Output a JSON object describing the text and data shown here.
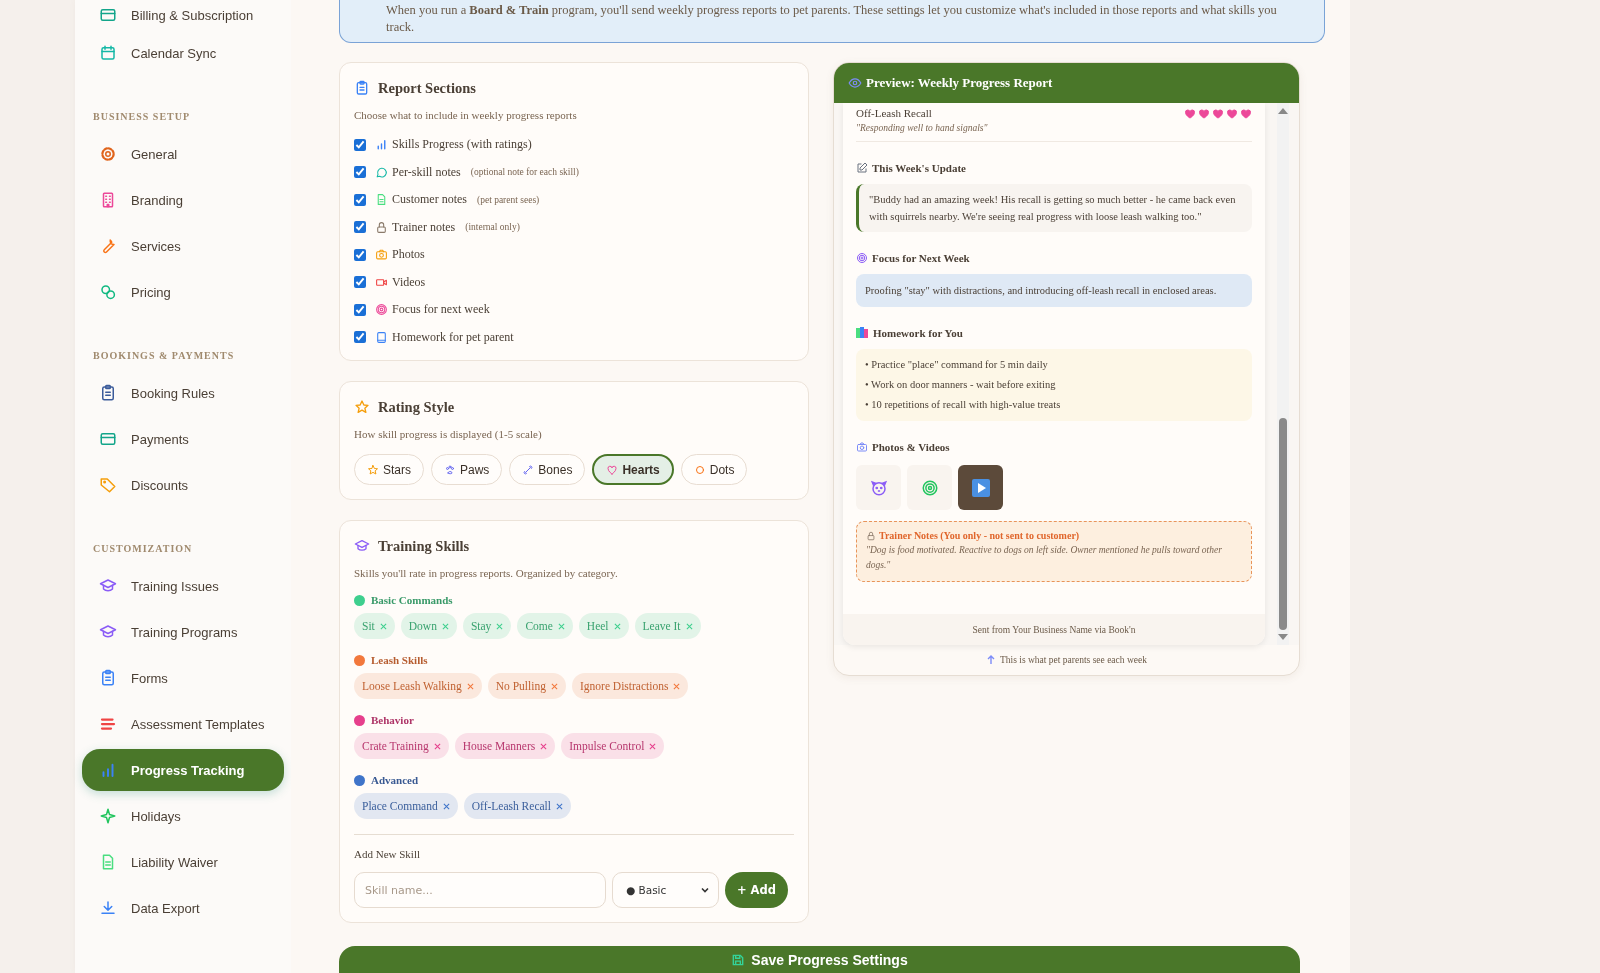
{
  "sidebar": {
    "sections": [
      {
        "items": [
          {
            "label": "Billing & Subscription",
            "kind": "card",
            "selected": false
          },
          {
            "label": "Calendar Sync",
            "kind": "calendar",
            "selected": false
          }
        ]
      },
      {
        "title": "BUSINESS SETUP",
        "items": [
          {
            "label": "General",
            "kind": "gear",
            "selected": false
          },
          {
            "label": "Branding",
            "kind": "building",
            "selected": false
          },
          {
            "label": "Services",
            "kind": "wrench",
            "selected": false
          },
          {
            "label": "Pricing",
            "kind": "coins",
            "selected": false
          }
        ]
      },
      {
        "title": "BOOKINGS & PAYMENTS",
        "items": [
          {
            "label": "Booking Rules",
            "kind": "clipboard",
            "selected": false
          },
          {
            "label": "Payments",
            "kind": "card",
            "selected": false
          },
          {
            "label": "Discounts",
            "kind": "tag",
            "selected": false
          }
        ]
      },
      {
        "title": "CUSTOMIZATION",
        "items": [
          {
            "label": "Training Issues",
            "kind": "cap",
            "selected": false
          },
          {
            "label": "Training Programs",
            "kind": "cap",
            "selected": false
          },
          {
            "label": "Forms",
            "kind": "form",
            "selected": false
          },
          {
            "label": "Assessment Templates",
            "kind": "lines",
            "selected": false
          },
          {
            "label": "Progress Tracking",
            "kind": "chart",
            "selected": true
          },
          {
            "label": "Holidays",
            "kind": "sparkle",
            "selected": false
          },
          {
            "label": "Liability Waiver",
            "kind": "doc",
            "selected": false
          },
          {
            "label": "Data Export",
            "kind": "download",
            "selected": false
          }
        ]
      }
    ]
  },
  "banner": {
    "text": "When you run a **Board & Train** program, you'll send weekly progress reports to pet parents. These settings let you customize what's included in those reports and what skills you track."
  },
  "report_sections": {
    "title": "Report Sections",
    "subtitle": "Choose what to include in weekly progress reports",
    "items": [
      {
        "label": "Skills Progress (with ratings)",
        "kind": "chart",
        "checked": true
      },
      {
        "label": "Per-skill notes",
        "note": "(optional note for each skill)",
        "kind": "chat",
        "checked": true
      },
      {
        "label": "Customer notes",
        "note": "(pet parent sees)",
        "kind": "doc",
        "checked": true
      },
      {
        "label": "Trainer notes",
        "note": "(internal only)",
        "kind": "lock",
        "checked": true
      },
      {
        "label": "Photos",
        "kind": "camera",
        "checked": true
      },
      {
        "label": "Videos",
        "kind": "video",
        "checked": true
      },
      {
        "label": "Focus for next week",
        "kind": "target",
        "checked": true
      },
      {
        "label": "Homework for pet parent",
        "kind": "book",
        "checked": true
      }
    ]
  },
  "rating_style": {
    "title": "Rating Style",
    "subtitle": "How skill progress is displayed (1-5 scale)",
    "options": [
      {
        "label": "Stars",
        "kind": "star",
        "selected": false
      },
      {
        "label": "Paws",
        "kind": "paw",
        "selected": false
      },
      {
        "label": "Bones",
        "kind": "bone",
        "selected": false
      },
      {
        "label": "Hearts",
        "kind": "heart",
        "selected": true
      },
      {
        "label": "Dots",
        "kind": "dot",
        "selected": false
      }
    ]
  },
  "training_skills": {
    "title": "Training Skills",
    "subtitle": "Skills you'll rate in progress reports. Organized by category.",
    "categories": [
      {
        "name": "Basic Commands",
        "color": "#3ecf8e",
        "skills": [
          "Sit",
          "Down",
          "Stay",
          "Come",
          "Heel",
          "Leave It"
        ]
      },
      {
        "name": "Leash Skills",
        "color": "#f2783c",
        "skills": [
          "Loose Leash Walking",
          "No Pulling",
          "Ignore Distractions"
        ]
      },
      {
        "name": "Behavior",
        "color": "#e63f8c",
        "skills": [
          "Crate Training",
          "House Manners",
          "Impulse Control"
        ]
      },
      {
        "name": "Advanced",
        "color": "#3f74c9",
        "skills": [
          "Place Command",
          "Off-Leash Recall"
        ]
      }
    ],
    "add_label": "Add New Skill",
    "placeholder": "Skill name...",
    "category_value": "● Basic",
    "add_button": "+ Add"
  },
  "preview": {
    "title": "Preview: Weekly Progress Report",
    "skill": {
      "name": "Off-Leash Recall",
      "stars": 5,
      "note": "\"Responding well to hand signals\""
    },
    "update_title": "This Week's Update",
    "update_text": "\"Buddy had an amazing week! His recall is getting so much better - he came back even with squirrels nearby. We're seeing real progress with loose leash walking too.\"",
    "focus_title": "Focus for Next Week",
    "focus_text": "Proofing \"stay\" with distractions, and introducing off-leash recall in enclosed areas.",
    "homework_title": "Homework for You",
    "homework": [
      "• Practice \"place\" command for 5 min daily",
      "• Work on door manners - wait before exiting",
      "• 10 repetitions of recall with high-value treats"
    ],
    "media_title": "Photos & Videos",
    "media": [
      {
        "kind": "dog"
      },
      {
        "kind": "target"
      },
      {
        "kind": "video"
      }
    ],
    "trainer_title": "Trainer Notes (You only - not sent to customer)",
    "trainer_text": "\"Dog is food motivated. Reactive to dogs on left side. Owner mentioned he pulls toward other dogs.\"",
    "footer": "Sent from Your Business Name via Book'n",
    "caption": "This is what pet parents see each week"
  },
  "save_button": "Save Progress Settings"
}
